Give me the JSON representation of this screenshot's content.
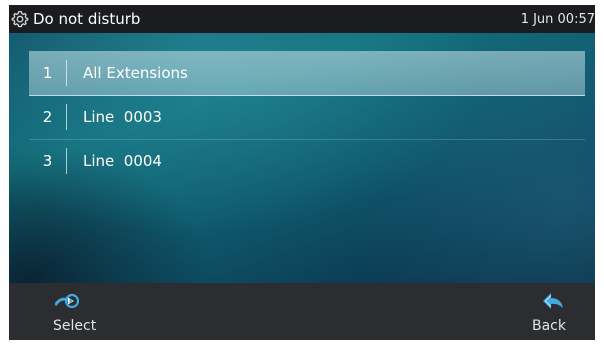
{
  "header": {
    "title": "Do not disturb",
    "datetime": "1 Jun 00:57",
    "icon": "gear-icon"
  },
  "menu": {
    "selected_index": 0,
    "items": [
      {
        "number": "1",
        "label": "All Extensions"
      },
      {
        "number": "2",
        "label": "Line  0003"
      },
      {
        "number": "3",
        "label": "Line  0004"
      }
    ]
  },
  "softkeys": {
    "left": {
      "label": "Select",
      "icon": "select-arrow-icon"
    },
    "right": {
      "label": "Back",
      "icon": "back-arrow-icon"
    }
  },
  "colors": {
    "header_bg": "#1a1c1f",
    "softkey_bg": "#2b2d30",
    "icon_blue": "#3fa9e0",
    "text": "#ffffff"
  }
}
